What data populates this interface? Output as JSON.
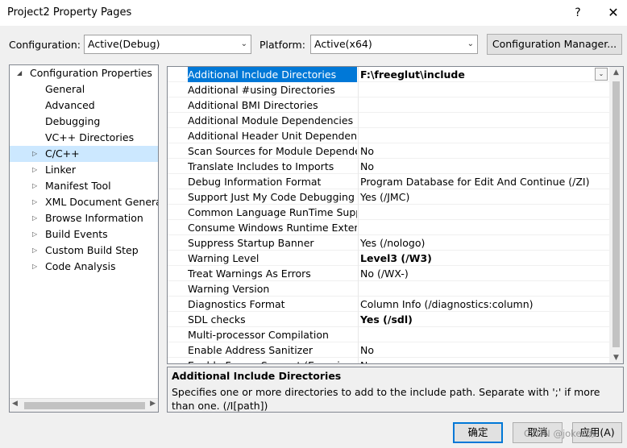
{
  "window": {
    "title": "Project2 Property Pages",
    "help_glyph": "?",
    "close_glyph": "✕"
  },
  "config_bar": {
    "configuration_label": "Configuration:",
    "configuration_value": "Active(Debug)",
    "platform_label": "Platform:",
    "platform_value": "Active(x64)",
    "config_manager_label": "Configuration Manager..."
  },
  "tree": {
    "items": [
      {
        "label": "Configuration Properties",
        "expanded": true
      },
      {
        "label": "General"
      },
      {
        "label": "Advanced"
      },
      {
        "label": "Debugging"
      },
      {
        "label": "VC++ Directories"
      },
      {
        "label": "C/C++",
        "selected": true
      },
      {
        "label": "Linker"
      },
      {
        "label": "Manifest Tool"
      },
      {
        "label": "XML Document Generat"
      },
      {
        "label": "Browse Information"
      },
      {
        "label": "Build Events"
      },
      {
        "label": "Custom Build Step"
      },
      {
        "label": "Code Analysis"
      }
    ]
  },
  "grid": {
    "rows": [
      {
        "name": "Additional Include Directories",
        "value": "F:\\freeglut\\include",
        "selected": true
      },
      {
        "name": "Additional #using Directories",
        "value": ""
      },
      {
        "name": "Additional BMI Directories",
        "value": ""
      },
      {
        "name": "Additional Module Dependencies",
        "value": ""
      },
      {
        "name": "Additional Header Unit Dependencies",
        "value": ""
      },
      {
        "name": "Scan Sources for Module Dependencies",
        "value": "No"
      },
      {
        "name": "Translate Includes to Imports",
        "value": "No"
      },
      {
        "name": "Debug Information Format",
        "value": "Program Database for Edit And Continue (/ZI)"
      },
      {
        "name": "Support Just My Code Debugging",
        "value": "Yes (/JMC)"
      },
      {
        "name": "Common Language RunTime Support",
        "value": ""
      },
      {
        "name": "Consume Windows Runtime Extension",
        "value": ""
      },
      {
        "name": "Suppress Startup Banner",
        "value": "Yes (/nologo)"
      },
      {
        "name": "Warning Level",
        "value": "Level3 (/W3)",
        "bold": true
      },
      {
        "name": "Treat Warnings As Errors",
        "value": "No (/WX-)"
      },
      {
        "name": "Warning Version",
        "value": ""
      },
      {
        "name": "Diagnostics Format",
        "value": "Column Info (/diagnostics:column)"
      },
      {
        "name": "SDL checks",
        "value": "Yes (/sdl)",
        "bold": true
      },
      {
        "name": "Multi-processor Compilation",
        "value": ""
      },
      {
        "name": "Enable Address Sanitizer",
        "value": "No"
      },
      {
        "name": "Enable Fuzzer Support (Experimental)",
        "value": "No"
      }
    ]
  },
  "description": {
    "title": "Additional Include Directories",
    "text": "Specifies one or more directories to add to the include path. Separate with ';' if more than one.     (/I[path])"
  },
  "buttons": {
    "ok": "确定",
    "cancel": "取消",
    "apply": "应用(A)"
  },
  "watermark": "CSDN @joker杨"
}
